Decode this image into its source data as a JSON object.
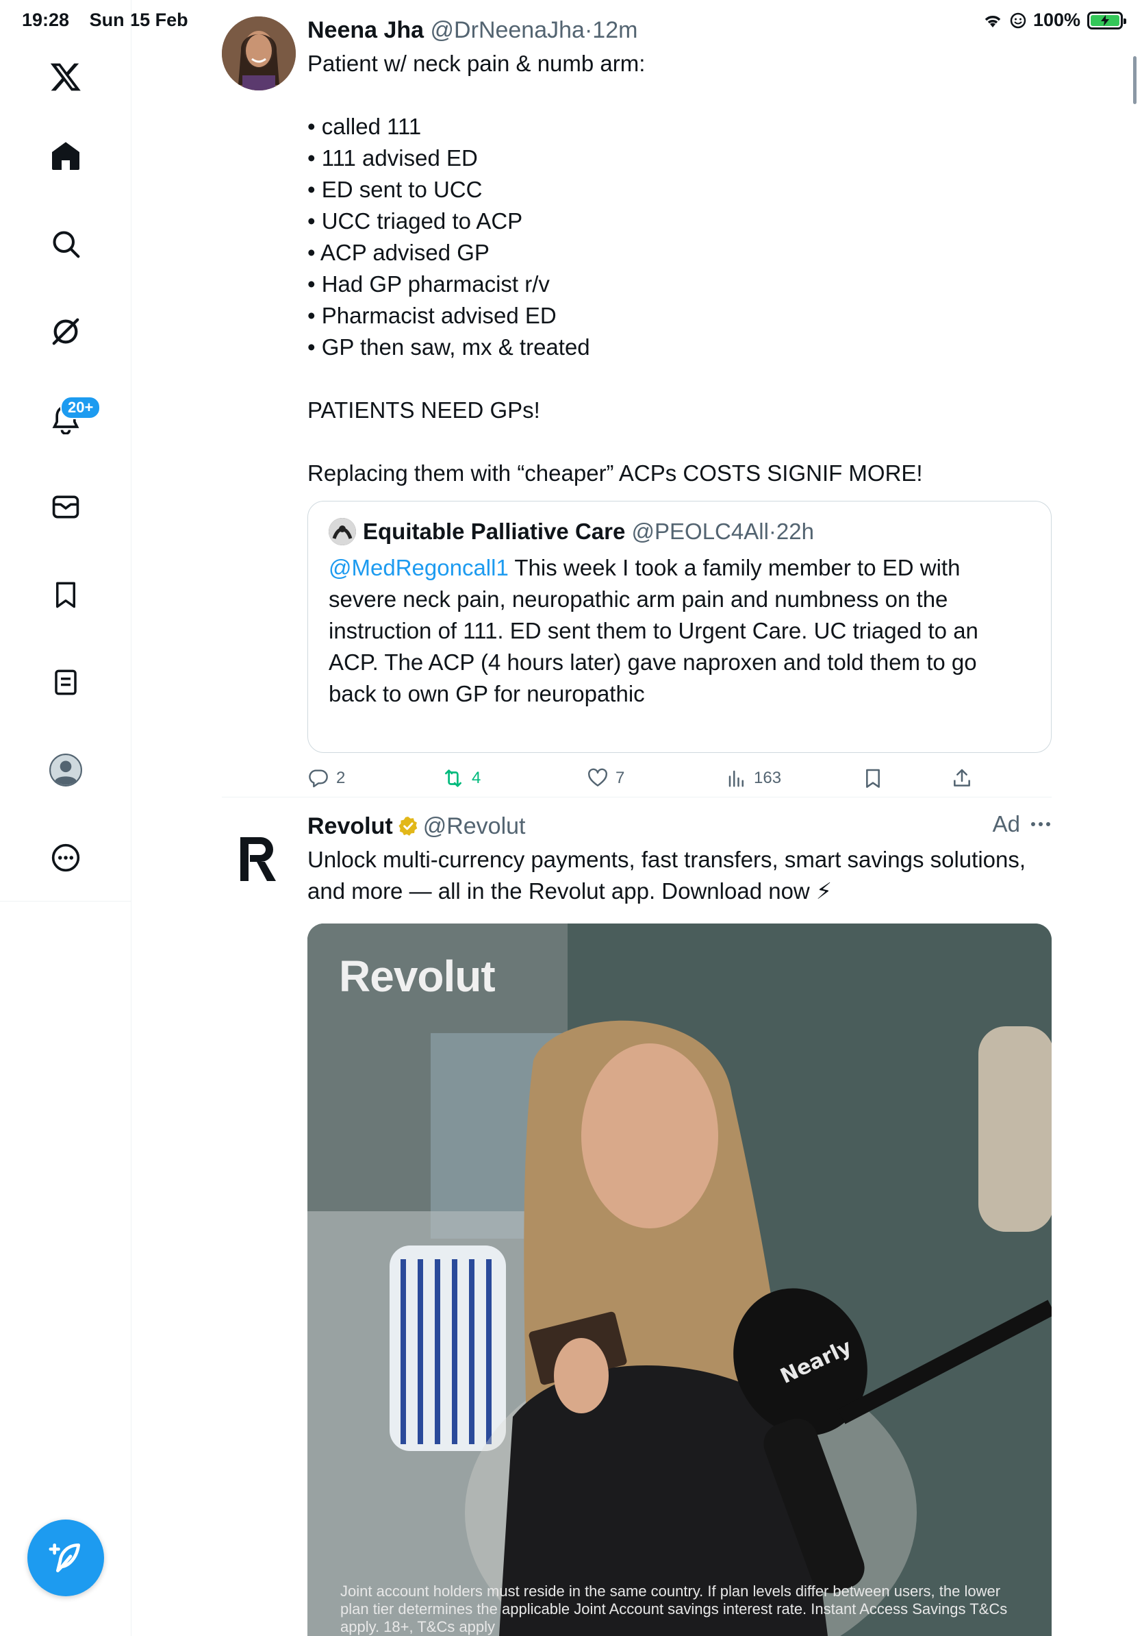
{
  "status_bar": {
    "time": "19:28",
    "date": "Sun 15 Feb",
    "battery": "100%"
  },
  "sidebar": {
    "items": [
      {
        "name": "x-logo"
      },
      {
        "name": "home"
      },
      {
        "name": "search"
      },
      {
        "name": "grok"
      },
      {
        "name": "notifications",
        "badge": "20+"
      },
      {
        "name": "messages"
      },
      {
        "name": "bookmarks"
      },
      {
        "name": "lists"
      },
      {
        "name": "profile"
      },
      {
        "name": "more"
      }
    ]
  },
  "tweet": {
    "author_name": "Neena Jha",
    "handle": "@DrNeenaJha",
    "separator": "·",
    "time": "12m",
    "lines": [
      "Patient w/ neck pain & numb arm:",
      "",
      "• called 111",
      "• 111 advised ED",
      "• ED sent to UCC",
      "• UCC triaged to ACP",
      "• ACP advised GP",
      "• Had GP pharmacist r/v",
      "• Pharmacist advised ED",
      "• GP then saw, mx & treated",
      "",
      "PATIENTS NEED GPs!",
      "",
      "Replacing them with “cheaper” ACPs COSTS SIGNIF MORE!"
    ],
    "quote": {
      "author_name": "Equitable Palliative Care",
      "handle": "@PEOLC4All",
      "separator": "·",
      "time": "22h",
      "mention": "@MedRegoncall1",
      "text": " This week I took a family member to ED with severe neck pain, neuropathic arm pain and numbness on the instruction of 111. ED sent them to Urgent Care. UC triaged to an ACP. The ACP (4 hours later) gave naproxen and told them to go back to own GP for neuropathic"
    },
    "actions": {
      "replies": "2",
      "retweets": "4",
      "likes": "7",
      "views": "163"
    }
  },
  "ad": {
    "author_name": "Revolut",
    "handle": "@Revolut",
    "label": "Ad",
    "text": "Unlock multi-currency payments, fast transfers, smart savings solutions, and more — all in the Revolut app. Download now ⚡",
    "media": {
      "brand_text": "Revolut",
      "caption": "Joint account holders must reside in the same country. If plan levels differ between users, the lower plan tier determines the applicable Joint Account savings interest rate. Instant Access Savings T&Cs apply. 18+, T&Cs apply"
    }
  },
  "colors": {
    "accent": "#1d9bf0",
    "retweet_green": "#00ba7c",
    "secondary_text": "#536471",
    "verified_gold": "#e2b719"
  }
}
